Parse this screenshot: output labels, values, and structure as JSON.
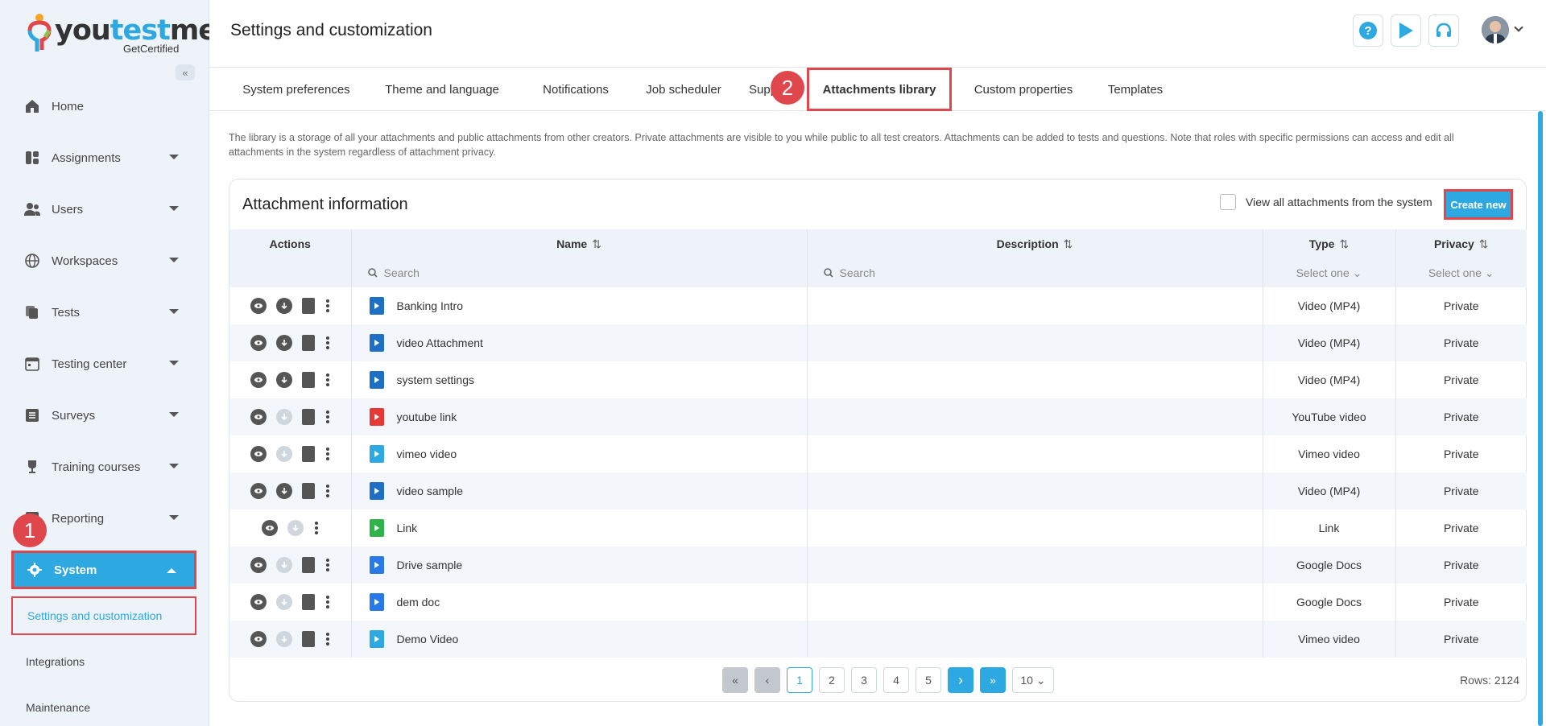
{
  "logo": {
    "word_a": "you",
    "word_b": "test",
    "word_c": "me",
    "sub": "GetCertified"
  },
  "sidebar": {
    "items": [
      {
        "label": "Home",
        "icon": "home-icon"
      },
      {
        "label": "Assignments",
        "icon": "assignments-icon"
      },
      {
        "label": "Users",
        "icon": "users-icon"
      },
      {
        "label": "Workspaces",
        "icon": "globe-icon"
      },
      {
        "label": "Tests",
        "icon": "tests-icon"
      },
      {
        "label": "Testing center",
        "icon": "calendar-icon"
      },
      {
        "label": "Surveys",
        "icon": "list-icon"
      },
      {
        "label": "Training courses",
        "icon": "trophy-icon"
      },
      {
        "label": "Reporting",
        "icon": "chart-icon"
      },
      {
        "label": "System",
        "icon": "gear-icon"
      }
    ],
    "sub_items": [
      {
        "label": "Settings and customization"
      },
      {
        "label": "Integrations"
      },
      {
        "label": "Maintenance"
      }
    ],
    "step1": "1"
  },
  "header": {
    "title": "Settings and customization"
  },
  "tabs": [
    {
      "label": "System preferences"
    },
    {
      "label": "Theme and language"
    },
    {
      "label": "Notifications"
    },
    {
      "label": "Job scheduler"
    },
    {
      "label": "Supp"
    },
    {
      "label": "Attachments library"
    },
    {
      "label": "Custom properties"
    },
    {
      "label": "Templates"
    }
  ],
  "step2": "2",
  "description": "The library is a storage of all your attachments and public attachments from other creators. Private attachments are visible to you while public to all test creators. Attachments can be added to tests and questions. Note that roles with specific permissions can access and edit all attachments in the system regardless of attachment privacy.",
  "card": {
    "title": "Attachment information",
    "view_all": "View all attachments from the system",
    "create_new": "Create new"
  },
  "table": {
    "headers": {
      "actions": "Actions",
      "name": "Name",
      "description": "Description",
      "type": "Type",
      "privacy": "Privacy"
    },
    "search_placeholder": "Search",
    "select_placeholder": "Select one",
    "rows": [
      {
        "name": "Banking Intro",
        "type": "Video (MP4)",
        "privacy": "Private",
        "icon": "video-file-icon",
        "color": "#1f6fc5",
        "download": true,
        "link": true
      },
      {
        "name": "video  Attachment",
        "type": "Video (MP4)",
        "privacy": "Private",
        "icon": "video-file-icon",
        "color": "#1f6fc5",
        "download": true,
        "link": true
      },
      {
        "name": "system settings",
        "type": "Video (MP4)",
        "privacy": "Private",
        "icon": "video-file-icon",
        "color": "#1f6fc5",
        "download": true,
        "link": true
      },
      {
        "name": "youtube link",
        "type": "YouTube video",
        "privacy": "Private",
        "icon": "youtube-file-icon",
        "color": "#e53935",
        "download": false,
        "link": true
      },
      {
        "name": "vimeo video",
        "type": "Vimeo video",
        "privacy": "Private",
        "icon": "vimeo-file-icon",
        "color": "#2ea8e0",
        "download": false,
        "link": true
      },
      {
        "name": "video sample",
        "type": "Video (MP4)",
        "privacy": "Private",
        "icon": "video-file-icon",
        "color": "#1f6fc5",
        "download": true,
        "link": true
      },
      {
        "name": "Link",
        "type": "Link",
        "privacy": "Private",
        "icon": "link-file-icon",
        "color": "#2fb34a",
        "download": false,
        "link": false
      },
      {
        "name": "Drive   sample",
        "type": "Google Docs",
        "privacy": "Private",
        "icon": "docs-file-icon",
        "color": "#2979e8",
        "download": false,
        "link": true
      },
      {
        "name": "dem  doc",
        "type": "Google Docs",
        "privacy": "Private",
        "icon": "docs-file-icon",
        "color": "#2979e8",
        "download": false,
        "link": true
      },
      {
        "name": "Demo Video",
        "type": "Vimeo video",
        "privacy": "Private",
        "icon": "vimeo-file-icon",
        "color": "#2ea8e0",
        "download": false,
        "link": true
      }
    ]
  },
  "pagination": {
    "pages": [
      "1",
      "2",
      "3",
      "4",
      "5"
    ],
    "current": "1",
    "page_size": "10",
    "rows": "Rows: 2124"
  },
  "colors": {
    "accent": "#2ea8e0",
    "highlight": "#e0474c"
  }
}
